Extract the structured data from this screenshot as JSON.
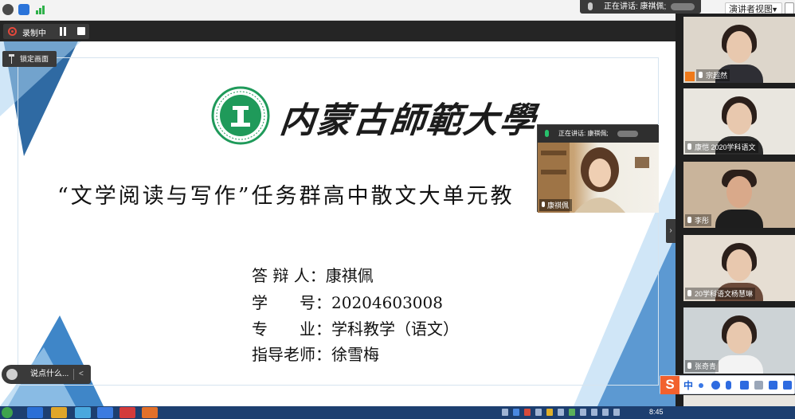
{
  "status_bar": {
    "speaking_label": "正在讲话: 康祺佩;",
    "view_mode": "演讲者视图"
  },
  "recording": {
    "label": "录制中"
  },
  "pin_button": "锁定画面",
  "slide": {
    "university_name": "内蒙古師範大學",
    "title": "“文学阅读与写作”任务群高中散文大单元教",
    "info": [
      {
        "label": "答 辩 人：",
        "value": "康祺佩"
      },
      {
        "label": "学　　号：",
        "value": "20204603008"
      },
      {
        "label": "专　　业：",
        "value": "学科教学（语文）"
      },
      {
        "label": "指导老师：",
        "value": "徐雪梅"
      }
    ]
  },
  "speaker_preview": {
    "header": "正在讲话: 康祺佩;",
    "name": "康祺佩"
  },
  "chat": {
    "placeholder": "说点什么..."
  },
  "participants": [
    {
      "name": "宗超然"
    },
    {
      "name": "康恺 2020学科语文"
    },
    {
      "name": "李彤"
    },
    {
      "name": "20学科语文杨慧琳"
    },
    {
      "name": "张奇青"
    }
  ],
  "ime": {
    "mode": "中"
  },
  "taskbar": {
    "clock": "8:45"
  },
  "colors": {
    "accent_blue": "#3f86c8",
    "triangle_light": "#a9d2f0",
    "recording_red": "#e3483b",
    "ime_orange": "#f2612e"
  }
}
